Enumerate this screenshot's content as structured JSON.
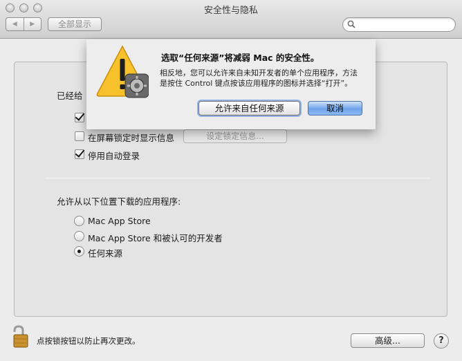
{
  "window": {
    "title": "安全性与隐私"
  },
  "toolbar": {
    "back_icon": "chevron-left-icon",
    "forward_icon": "chevron-right-icon",
    "show_all_label": "全部显示",
    "search_placeholder": ""
  },
  "general": {
    "section_label": "已经给",
    "checkbox_require_password": {
      "checked": true
    },
    "checkbox_lock_message": {
      "label": "在屏幕锁定时显示信息",
      "checked": false
    },
    "set_lock_message_button": "设定锁定信息...",
    "checkbox_disable_auto_login": {
      "label": "停用自动登录",
      "checked": true
    }
  },
  "downloads": {
    "heading": "允许从以下位置下载的应用程序:",
    "options": [
      {
        "label": "Mac App Store",
        "selected": false
      },
      {
        "label": "Mac App Store 和被认可的开发者",
        "selected": false
      },
      {
        "label": "任何来源",
        "selected": true
      }
    ]
  },
  "alert": {
    "title": "选取“任何来源”将减弱 Mac 的安全性。",
    "body_line1": "相反地，您可以允许来自未知开发者的单个应用程序，方法",
    "body_line2": "是按住 Control 键点按该应用程序的图标并选择“打开”。",
    "allow_button": "允许来自任何来源",
    "cancel_button": "取消",
    "icon": "warning-icon"
  },
  "footer": {
    "lock_text": "点按锁按钮以防止再次更改。",
    "advanced_button": "高级...",
    "help_button": "?"
  },
  "colors": {
    "default_button": "#6fa3ea",
    "focus_ring": "#8fb3e6",
    "warning_yellow": "#f7c12c"
  }
}
